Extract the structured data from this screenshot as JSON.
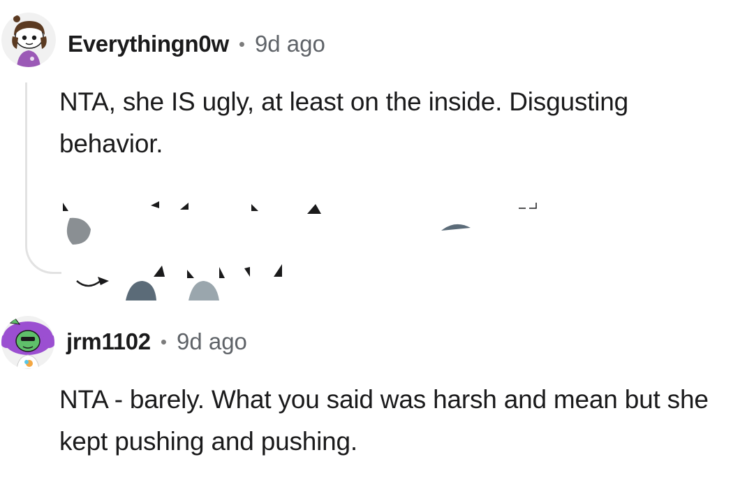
{
  "comments": [
    {
      "username": "Everythingn0w",
      "separator": "•",
      "time": "9d ago",
      "body": "NTA, she IS ugly, at least on the inside. Disgusting behavior.",
      "avatar_icon": "snoo-avatar-purple-shirt-icon"
    },
    {
      "username": "jrm1102",
      "separator": "•",
      "time": "9d ago",
      "body": "NTA - barely. What you said was harsh and mean but she kept pushing and pushing.",
      "avatar_icon": "snoo-avatar-green-purple-hair-icon"
    }
  ],
  "colors": {
    "text": "#1a1a1b",
    "meta": "#5f6368",
    "thread_line": "#e2e2e2",
    "artifact_dark": "#5b6b78",
    "artifact_light": "#9aa6ad"
  }
}
